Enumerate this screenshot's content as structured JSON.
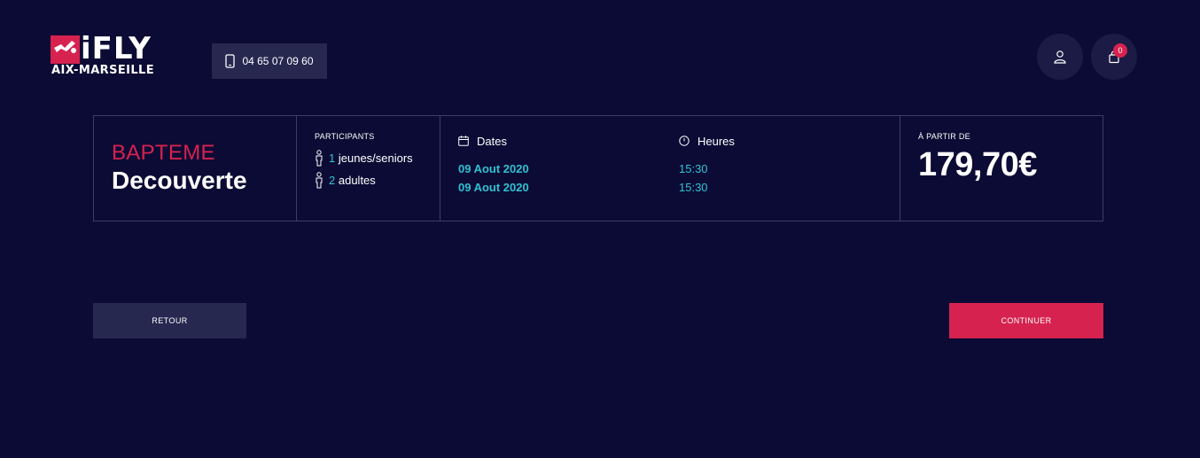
{
  "header": {
    "logo_word": "iFLY",
    "logo_sub": "AIX-MARSEILLE",
    "phone": "04 65 07 09 60",
    "cart_count": "0"
  },
  "product": {
    "category": "BAPTEME",
    "name": "Decouverte"
  },
  "participants": {
    "label": "PARTICIPANTS",
    "items": [
      {
        "count": "1",
        "label": "jeunes/seniors"
      },
      {
        "count": "2",
        "label": "adultes"
      }
    ]
  },
  "schedule": {
    "dates_label": "Dates",
    "hours_label": "Heures",
    "dates": [
      "09 Aout 2020",
      "09 Aout 2020"
    ],
    "hours": [
      "15:30",
      "15:30"
    ]
  },
  "price": {
    "label": "À PARTIR DE",
    "value": "179,70€"
  },
  "actions": {
    "back_label": "RETOUR",
    "continue_label": "CONTINUER"
  },
  "colors": {
    "background": "#0c0b35",
    "accent": "#d6224f",
    "highlight": "#2fc2d2",
    "secondary_button": "#262850"
  }
}
